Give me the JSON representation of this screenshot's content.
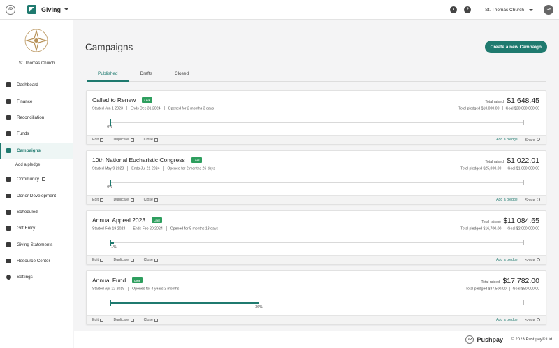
{
  "topbar": {
    "app_name": "Giving",
    "church": "St. Thomas Church",
    "avatar": "GB"
  },
  "sidebar": {
    "church_name": "St. Thomas Church",
    "items": [
      {
        "label": "Dashboard",
        "icon": "dashboard-icon"
      },
      {
        "label": "Finance",
        "icon": "finance-icon"
      },
      {
        "label": "Reconciliation",
        "icon": "reconciliation-icon"
      },
      {
        "label": "Funds",
        "icon": "funds-icon"
      },
      {
        "label": "Campaigns",
        "icon": "campaigns-icon",
        "active": true
      },
      {
        "label": "Community",
        "icon": "community-icon"
      },
      {
        "label": "Donor Development",
        "icon": "donor-icon"
      },
      {
        "label": "Scheduled",
        "icon": "scheduled-icon"
      },
      {
        "label": "Gift Entry",
        "icon": "gift-entry-icon"
      },
      {
        "label": "Giving Statements",
        "icon": "statements-icon"
      },
      {
        "label": "Resource Center",
        "icon": "resource-icon"
      },
      {
        "label": "Settings",
        "icon": "gear-icon"
      }
    ],
    "sub_item": "Add a pledge"
  },
  "main": {
    "title": "Campaigns",
    "create_button": "Create a new Campaign",
    "tabs": [
      "Published",
      "Drafts",
      "Closed"
    ],
    "campaigns": [
      {
        "name": "Called to Renew",
        "badge": "LIVE",
        "started": "Started Jun 1 2023",
        "ends": "Ends Dec 31 2024",
        "opened": "Opened for 2 months 3 days",
        "raised_label": "Total raised:",
        "raised": "$1,648.45",
        "pledged": "Total pledged $10,000.00",
        "goal": "Goal $20,000,000.00",
        "percent": 0,
        "percent_label": "0%"
      },
      {
        "name": "10th National Eucharistic Congress",
        "badge": "LIVE",
        "started": "Started May 9 2023",
        "ends": "Ends Jul 21 2024",
        "opened": "Opened for 2 months 26 days",
        "raised_label": "Total raised:",
        "raised": "$1,022.01",
        "pledged": "Total pledged $25,000.00",
        "goal": "Goal $1,000,000.00",
        "percent": 0,
        "percent_label": "0%"
      },
      {
        "name": "Annual Appeal 2023",
        "badge": "LIVE",
        "started": "Started Feb 19 2023",
        "ends": "Ends Feb 20 2024",
        "opened": "Opened for 5 months 13 days",
        "raised_label": "Total raised:",
        "raised": "$11,084.65",
        "pledged": "Total pledged $16,700.00",
        "goal": "Goal $2,000,000.00",
        "percent": 1,
        "percent_label": "1%"
      },
      {
        "name": "Annual Fund",
        "badge": "LIVE",
        "started": "Started Apr 12 2019",
        "ends": "",
        "opened": "Opened for 4 years 3 months",
        "raised_label": "Total raised:",
        "raised": "$17,782.00",
        "pledged": "Total pledged $37,500.00",
        "goal": "Goal $50,000.00",
        "percent": 36,
        "percent_label": "36%"
      }
    ],
    "actions": {
      "edit": "Edit",
      "duplicate": "Duplicate",
      "close": "Close",
      "add_pledge": "Add a pledge",
      "share": "Share"
    }
  },
  "footer": {
    "brand": "Pushpay",
    "copyright": "© 2023 Pushpay® Ltd."
  },
  "colors": {
    "accent": "#1f7a6f",
    "live": "#2e9e5e"
  }
}
